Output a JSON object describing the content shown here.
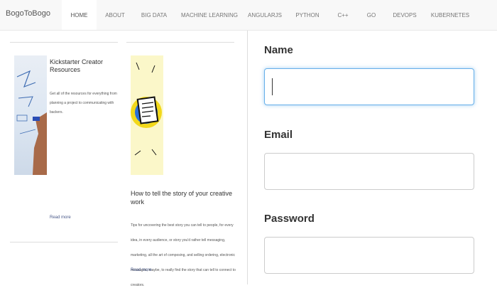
{
  "navbar": {
    "brand": "BogoToBogo",
    "items": [
      {
        "label": "HOME"
      },
      {
        "label": "ABOUT"
      },
      {
        "label": "BIG DATA"
      },
      {
        "label": "MACHINE LEARNING"
      },
      {
        "label": "ANGULARJS"
      },
      {
        "label": "PYTHON"
      },
      {
        "label": "C++"
      },
      {
        "label": "GO"
      },
      {
        "label": "DEVOPS"
      },
      {
        "label": "KUBERNETES"
      }
    ],
    "active_index": 0
  },
  "cards": [
    {
      "title": "Kickstarter Creator Resources",
      "description": "Get all of the resources for everything from planning a project to communicating with backers.",
      "read_more": "Read more"
    },
    {
      "title": "How to tell the story of your creative work",
      "description": "Tips for uncovering the best story you can tell to people, for every idea, in every audience, or story you'd rather tell messaging, marketing, all the art of composing, and selling ordering, electronic messages, maybe, to really find the story that can tell to connect to creators.",
      "read_more": "Read more"
    }
  ],
  "form": {
    "name_label": "Name",
    "name_value": "",
    "email_label": "Email",
    "email_value": "",
    "password_label": "Password",
    "password_value": ""
  }
}
